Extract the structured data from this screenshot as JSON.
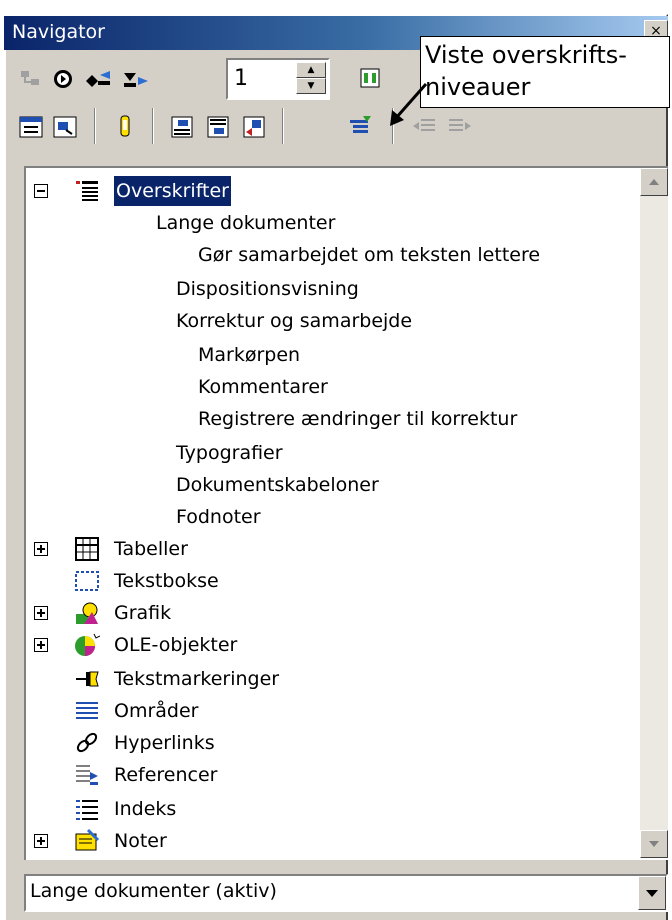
{
  "window": {
    "title": "Navigator",
    "close_label": "×"
  },
  "toolbar": {
    "heading_level_value": "1"
  },
  "callout": {
    "line1": "Viste overskrifts-",
    "line2": "niveauer"
  },
  "tree": {
    "root": {
      "label": "Overskrifter"
    },
    "headings": [
      {
        "label": "Lange dokumenter"
      },
      {
        "label": "Gør samarbejdet om teksten lettere"
      },
      {
        "label": "Dispositionsvisning"
      },
      {
        "label": "Korrektur og samarbejde"
      },
      {
        "label": "Markørpen"
      },
      {
        "label": "Kommentarer"
      },
      {
        "label": "Registrere ændringer til korrektur"
      },
      {
        "label": "Typografier"
      },
      {
        "label": "Dokumentskabeloner"
      },
      {
        "label": "Fodnoter"
      }
    ],
    "categories": [
      {
        "label": "Tabeller",
        "icon": "table-icon"
      },
      {
        "label": "Tekstbokse",
        "icon": "textbox-icon"
      },
      {
        "label": "Grafik",
        "icon": "graphics-icon"
      },
      {
        "label": "OLE-objekter",
        "icon": "ole-object-icon"
      },
      {
        "label": "Tekstmarkeringer",
        "icon": "bookmark-icon"
      },
      {
        "label": "Områder",
        "icon": "section-icon"
      },
      {
        "label": "Hyperlinks",
        "icon": "hyperlink-icon"
      },
      {
        "label": "Referencer",
        "icon": "reference-icon"
      },
      {
        "label": "Indeks",
        "icon": "index-icon"
      },
      {
        "label": "Noter",
        "icon": "note-icon"
      }
    ]
  },
  "document_select": {
    "value": "Lange dokumenter (aktiv)"
  }
}
